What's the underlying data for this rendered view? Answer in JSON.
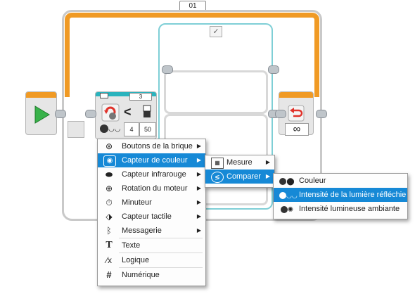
{
  "loop": {
    "label": "01"
  },
  "switch": {
    "case_true_icon": "checkmark-icon",
    "case_false_icon": "x-icon"
  },
  "sensor_block": {
    "port": "3",
    "operator": "<",
    "param1": "4",
    "param2": "50"
  },
  "loop_end": {
    "mode_icon": "infinity-icon",
    "mode_symbol": "∞"
  },
  "menu_main": {
    "items": [
      {
        "label": "Boutons de la brique",
        "icon": "brick-buttons-icon",
        "has_submenu": true,
        "selected": false
      },
      {
        "label": "Capteur de couleur",
        "icon": "color-sensor-icon",
        "has_submenu": true,
        "selected": true
      },
      {
        "label": "Capteur infrarouge",
        "icon": "infrared-sensor-icon",
        "has_submenu": true,
        "selected": false
      },
      {
        "label": "Rotation du moteur",
        "icon": "motor-rotation-icon",
        "has_submenu": true,
        "selected": false
      },
      {
        "label": "Minuteur",
        "icon": "timer-icon",
        "has_submenu": true,
        "selected": false
      },
      {
        "label": "Capteur tactile",
        "icon": "touch-sensor-icon",
        "has_submenu": true,
        "selected": false
      },
      {
        "label": "Messagerie",
        "icon": "bluetooth-icon",
        "has_submenu": true,
        "selected": false
      },
      {
        "label": "Texte",
        "icon": "text-icon",
        "has_submenu": false,
        "selected": false
      },
      {
        "label": "Logique",
        "icon": "logic-icon",
        "has_submenu": false,
        "selected": false
      },
      {
        "label": "Numérique",
        "icon": "hash-icon",
        "has_submenu": false,
        "selected": false
      }
    ]
  },
  "menu_sub": {
    "items": [
      {
        "label": "Mesure",
        "icon": "measure-icon",
        "has_submenu": true,
        "selected": false
      },
      {
        "label": "Comparer",
        "icon": "compare-icon",
        "has_submenu": true,
        "selected": true
      }
    ]
  },
  "menu_sub2": {
    "items": [
      {
        "label": "Couleur",
        "icon": "color-icon",
        "selected": false
      },
      {
        "label": "Intensité de la lumière réfléchie",
        "icon": "reflected-light-icon",
        "selected": true
      },
      {
        "label": "Intensité lumineuse ambiante",
        "icon": "ambient-light-icon",
        "selected": false
      }
    ]
  },
  "colors": {
    "orange": "#f09a24",
    "teal": "#2ab3bd",
    "selected": "#1689d6",
    "start_green": "#38b24a",
    "red": "#e0332b"
  }
}
